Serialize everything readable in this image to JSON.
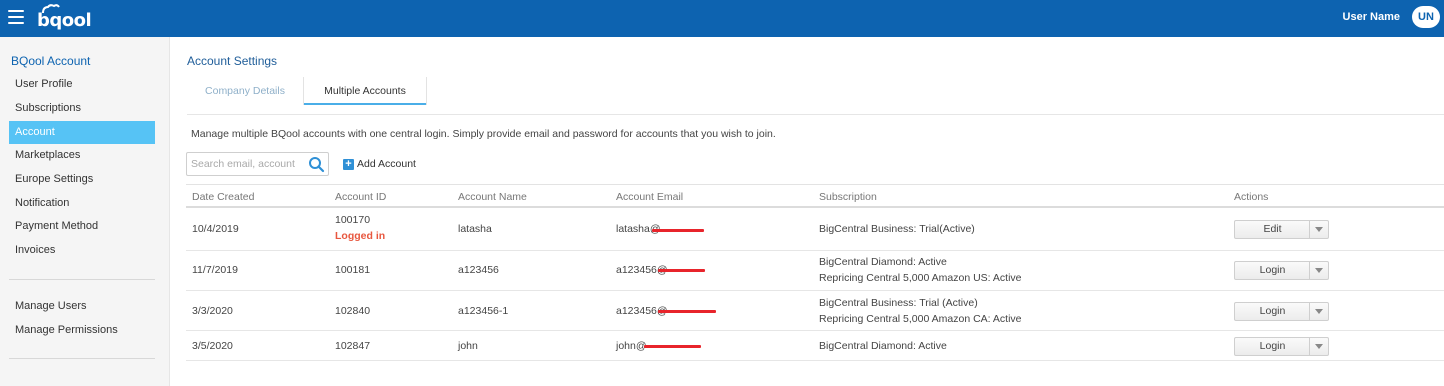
{
  "header": {
    "logo_text": "bqool",
    "user_name": "User Name",
    "avatar_initials": "UN",
    "bar_color": "#0d63b0"
  },
  "sidebar": {
    "title": "BQool Account",
    "items": [
      {
        "label": "User Profile",
        "active": false
      },
      {
        "label": "Subscriptions",
        "active": false
      },
      {
        "label": "Account",
        "active": true
      },
      {
        "label": "Marketplaces",
        "active": false
      },
      {
        "label": "Europe Settings",
        "active": false
      },
      {
        "label": "Notification",
        "active": false
      },
      {
        "label": "Payment Method",
        "active": false
      },
      {
        "label": "Invoices",
        "active": false
      }
    ],
    "manage_items": [
      {
        "label": "Manage Users"
      },
      {
        "label": "Manage Permissions"
      }
    ],
    "active_color": "#56c3f5"
  },
  "main": {
    "title": "Account Settings",
    "tabs": [
      {
        "label": "Company Details",
        "active": false
      },
      {
        "label": "Multiple Accounts",
        "active": true
      }
    ],
    "description": "Manage multiple BQool accounts with one central login. Simply provide email and password for accounts that you wish to join.",
    "search": {
      "placeholder": "Search email, account",
      "value": ""
    },
    "add_account_label": "Add Account",
    "table": {
      "columns": [
        "Date Created",
        "Account ID",
        "Account Name",
        "Account Email",
        "Subscription",
        "Actions"
      ],
      "rows": [
        {
          "date": "10/4/2019",
          "id": "100170",
          "status": "Logged in",
          "name": "latasha",
          "email": "latasha@",
          "subscription": [
            "BigCentral Business: Trial(Active)"
          ],
          "action": "Edit"
        },
        {
          "date": "11/7/2019",
          "id": "100181",
          "status": "",
          "name": "a123456",
          "email": "a123456@",
          "subscription": [
            "BigCentral Diamond: Active",
            "Repricing Central 5,000 Amazon US: Active"
          ],
          "action": "Login"
        },
        {
          "date": "3/3/2020",
          "id": "102840",
          "status": "",
          "name": "a123456-1",
          "email": "a123456@",
          "subscription": [
            "BigCentral Business: Trial (Active)",
            "Repricing Central 5,000 Amazon CA: Active"
          ],
          "action": "Login"
        },
        {
          "date": "3/5/2020",
          "id": "102847",
          "status": "",
          "name": "john",
          "email": "john@",
          "subscription": [
            "BigCentral Diamond: Active"
          ],
          "action": "Login"
        }
      ]
    }
  }
}
